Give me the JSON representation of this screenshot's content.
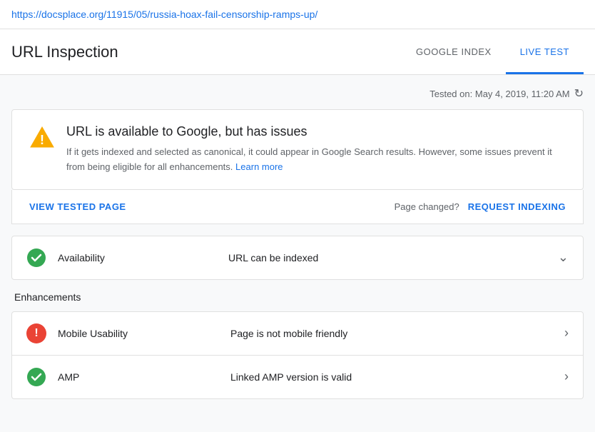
{
  "url_bar": {
    "url": "https://docsplace.org/11915/05/russia-hoax-fail-censorship-ramps-up/"
  },
  "header": {
    "title": "URL Inspection",
    "tabs": [
      {
        "id": "google-index",
        "label": "GOOGLE INDEX",
        "active": false
      },
      {
        "id": "live-test",
        "label": "LIVE TEST",
        "active": true
      }
    ]
  },
  "content": {
    "tested_on_label": "Tested on:",
    "tested_on_date": "May 4, 2019, 11:20 AM",
    "status_card": {
      "title": "URL is available to Google, but has issues",
      "description": "If it gets indexed and selected as canonical, it could appear in Google Search results. However, some issues prevent it from being eligible for all enhancements.",
      "learn_more_label": "Learn more"
    },
    "actions": {
      "view_tested_page_label": "VIEW TESTED PAGE",
      "page_changed_label": "Page changed?",
      "request_indexing_label": "REQUEST INDEXING"
    },
    "availability": {
      "label": "Availability",
      "value": "URL can be indexed"
    },
    "enhancements_title": "Enhancements",
    "enhancements": [
      {
        "label": "Mobile Usability",
        "value": "Page is not mobile friendly",
        "status": "error"
      },
      {
        "label": "AMP",
        "value": "Linked AMP version is valid",
        "status": "success"
      }
    ]
  }
}
